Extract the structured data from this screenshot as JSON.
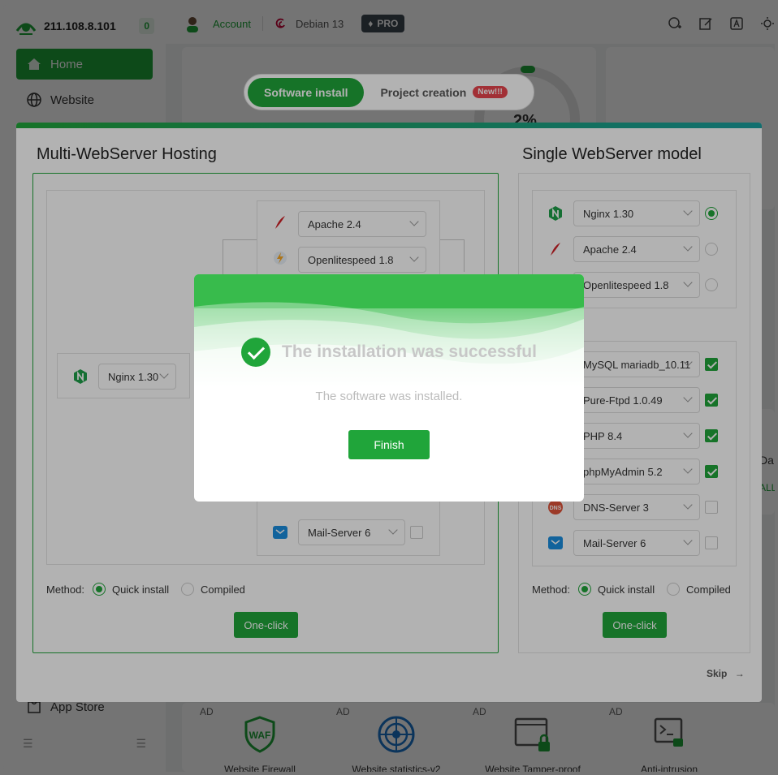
{
  "sidebar": {
    "server_ip": "211.108.8.101",
    "ip_count": "0",
    "nav": [
      {
        "label": "Home",
        "icon": "home-icon",
        "active": true
      },
      {
        "label": "Website",
        "icon": "globe-icon",
        "active": false
      },
      {
        "label": "App Store",
        "icon": "store-icon",
        "active": false
      }
    ]
  },
  "topbar": {
    "account_label": "Account",
    "os_label": "Debian 13",
    "pro_label": "PRO"
  },
  "dashboard": {
    "gauge_value": "2%",
    "ads": [
      {
        "tag": "AD",
        "label": "Website Firewall",
        "icon": "waf-shield-icon"
      },
      {
        "tag": "AD",
        "label": "Website statistics-v2",
        "icon": "radar-icon"
      },
      {
        "tag": "AD",
        "label": "Website Tamper-proof",
        "icon": "tamper-lock-icon"
      },
      {
        "tag": "AD",
        "label": "Anti-intrusion",
        "icon": "terminal-lock-icon"
      }
    ],
    "partial_right_text": "Da",
    "partial_right_link": "ALL"
  },
  "tabs": {
    "software_install": "Software install",
    "project_creation": "Project creation",
    "new_badge": "New!!!"
  },
  "wizard": {
    "multi": {
      "title": "Multi-WebServer Hosting",
      "nginx": "Nginx 1.30",
      "apache": "Apache 2.4",
      "openlitespeed": "Openlitespeed 1.8",
      "mail": "Mail-Server 6",
      "method_label": "Method:",
      "quick_install": "Quick install",
      "compiled": "Compiled",
      "one_click": "One-click"
    },
    "single": {
      "title": "Single WebServer model",
      "servers": [
        {
          "name": "Nginx 1.30",
          "selected": true
        },
        {
          "name": "Apache 2.4",
          "selected": false
        },
        {
          "name": "Openlitespeed 1.8",
          "selected": false
        }
      ],
      "packages": [
        {
          "name": "MySQL mariadb_10.11",
          "checked": true
        },
        {
          "name": "Pure-Ftpd 1.0.49",
          "checked": true
        },
        {
          "name": "PHP 8.4",
          "checked": true
        },
        {
          "name": "phpMyAdmin 5.2",
          "checked": true
        },
        {
          "name": "DNS-Server 3",
          "checked": false
        },
        {
          "name": "Mail-Server 6",
          "checked": false
        }
      ],
      "method_label": "Method:",
      "quick_install": "Quick install",
      "compiled": "Compiled",
      "one_click": "One-click"
    },
    "skip_label": "Skip"
  },
  "dialog": {
    "title": "The installation was successful",
    "message": "The software was installed.",
    "finish_label": "Finish"
  },
  "colors": {
    "brand_green": "#20a53a",
    "new_badge_red": "#e8464e"
  }
}
